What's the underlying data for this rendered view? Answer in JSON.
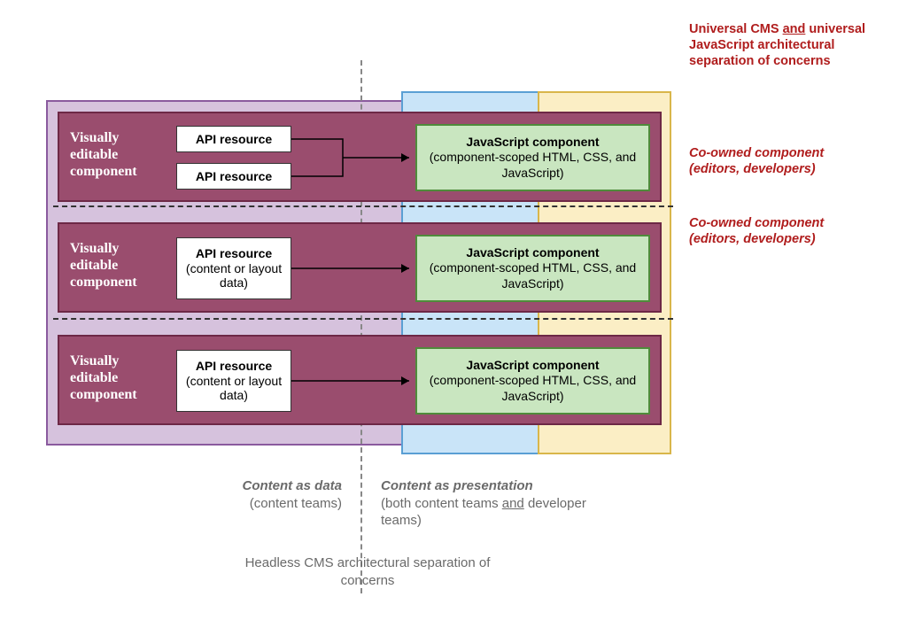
{
  "top_right": {
    "line1": "Universal CMS ",
    "underlined": "and",
    "line2_rest": " universal JavaScript architectural separation of concerns"
  },
  "right_labels": [
    {
      "title": "Co-owned component",
      "sub": "(editors, developers)"
    },
    {
      "title": "Co-owned component",
      "sub": "(editors, developers)"
    }
  ],
  "rows": [
    {
      "label": "Visually editable component",
      "api": [
        {
          "title": "API resource",
          "sub": ""
        },
        {
          "title": "API resource",
          "sub": ""
        }
      ],
      "js": {
        "title": "JavaScript component",
        "sub": "(component-scoped HTML, CSS, and JavaScript)"
      }
    },
    {
      "label": "Visually editable component",
      "api": [
        {
          "title": "API resource",
          "sub": "(content or layout data)"
        }
      ],
      "js": {
        "title": "JavaScript component",
        "sub": "(component-scoped HTML, CSS, and JavaScript)"
      }
    },
    {
      "label": "Visually editable component",
      "api": [
        {
          "title": "API resource",
          "sub": "(content or layout data)"
        }
      ],
      "js": {
        "title": "JavaScript component",
        "sub": "(component-scoped HTML, CSS, and JavaScript)"
      }
    }
  ],
  "bottom": {
    "left_title": "Content as data",
    "left_sub": "(content teams)",
    "right_title": "Content as presentation",
    "right_sub_pre": "(both content teams ",
    "right_sub_ul": "and",
    "right_sub_post": " developer teams)",
    "headless": "Headless CMS architectural separation of concerns"
  }
}
